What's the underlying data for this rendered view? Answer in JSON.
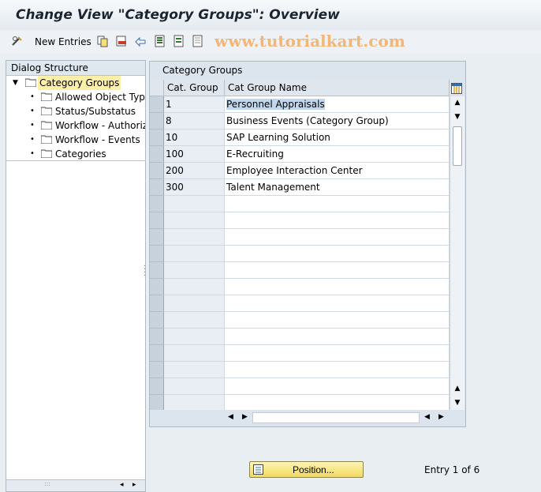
{
  "window": {
    "title": "Change View \"Category Groups\": Overview"
  },
  "toolbar": {
    "new_entries_label": "New Entries",
    "icons": [
      "edit-glasses-icon",
      "copy-icon",
      "delete-icon",
      "undo-icon",
      "select-all-icon",
      "select-block-icon",
      "deselect-all-icon"
    ]
  },
  "watermark": "www.tutorialkart.com",
  "dialog_structure": {
    "heading": "Dialog Structure",
    "root": "Category Groups",
    "children": [
      "Allowed Object Type",
      "Status/Substatus",
      "Workflow - Authorize",
      "Workflow - Events",
      "Categories"
    ]
  },
  "table": {
    "title": "Category Groups",
    "columns": [
      "Cat. Group",
      "Cat Group Name"
    ],
    "rows": [
      [
        "1",
        "Personnel Appraisals"
      ],
      [
        "8",
        "Business Events (Category Group)"
      ],
      [
        "10",
        "SAP Learning Solution"
      ],
      [
        "100",
        "E-Recruiting"
      ],
      [
        "200",
        "Employee Interaction Center"
      ],
      [
        "300",
        "Talent Management"
      ]
    ],
    "empty_rows": 13
  },
  "footer": {
    "position_button": "Position...",
    "entry_info": "Entry 1 of 6"
  },
  "colors": {
    "selection": "#fdeea8",
    "highlight": "#c2d7ec",
    "button_yellow": "#f3d95e",
    "watermark": "#f2b676"
  }
}
